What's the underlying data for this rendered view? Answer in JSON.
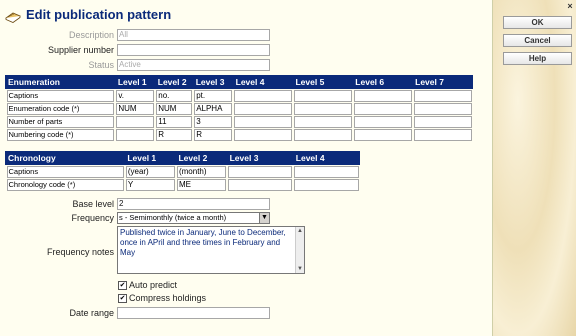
{
  "title": "Edit publication pattern",
  "sidebar": {
    "ok": "OK",
    "cancel": "Cancel",
    "help": "Help",
    "close": "×"
  },
  "fields": {
    "description": {
      "label": "Description",
      "value": "All"
    },
    "supplier": {
      "label": "Supplier number",
      "value": ""
    },
    "status": {
      "label": "Status",
      "value": "Active"
    }
  },
  "enumeration": {
    "headers": [
      "Enumeration",
      "Level 1",
      "Level 2",
      "Level 3",
      "Level 4",
      "Level 5",
      "Level 6",
      "Level 7"
    ],
    "rows": [
      {
        "label": "Captions",
        "values": [
          "v.",
          "no.",
          "pt.",
          "",
          "",
          "",
          ""
        ]
      },
      {
        "label": "Enumeration code (*)",
        "values": [
          "NUM",
          "NUM",
          "ALPHA",
          "",
          "",
          "",
          ""
        ]
      },
      {
        "label": "Number of parts",
        "values": [
          "",
          "11",
          "3",
          "",
          "",
          "",
          ""
        ]
      },
      {
        "label": "Numbering code (*)",
        "values": [
          "",
          "R",
          "R",
          "",
          "",
          "",
          ""
        ]
      }
    ]
  },
  "chronology": {
    "headers": [
      "Chronology",
      "Level 1",
      "Level 2",
      "Level 3",
      "Level 4"
    ],
    "rows": [
      {
        "label": "Captions",
        "values": [
          "(year)",
          "(month)",
          "",
          ""
        ]
      },
      {
        "label": "Chronology code (*)",
        "values": [
          "Y",
          "ME",
          "",
          ""
        ]
      }
    ]
  },
  "base_level": {
    "label": "Base level",
    "value": "2"
  },
  "frequency": {
    "label": "Frequency",
    "value": "s - Semimonthly (twice a month)"
  },
  "frequency_notes": {
    "label": "Frequency notes",
    "value": "Published twice in January, June to December, once in APril and three times in February and May"
  },
  "auto_predict": {
    "label": "Auto predict",
    "checked": "✔"
  },
  "compress_holdings": {
    "label": "Compress holdings",
    "checked": "✔"
  },
  "date_range": {
    "label": "Date range",
    "value": ""
  }
}
